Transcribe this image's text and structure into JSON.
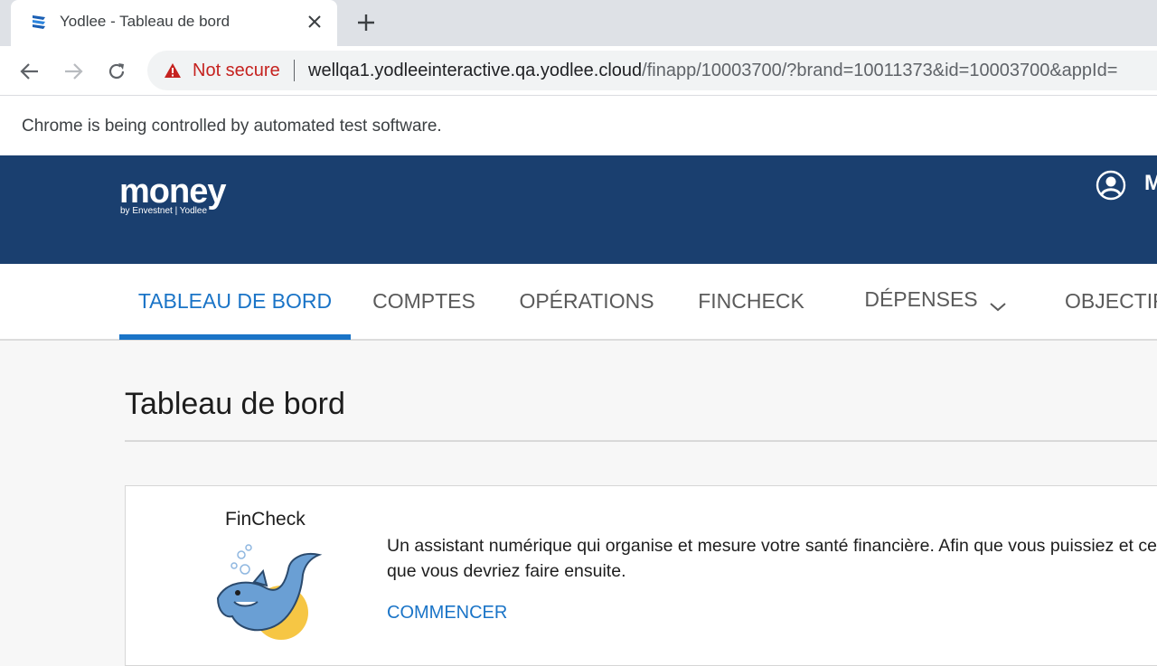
{
  "browser": {
    "tab_title": "Yodlee - Tableau de bord",
    "security_label": "Not secure",
    "url_host": "wellqa1.yodleeinteractive.qa.yodlee.cloud",
    "url_path": "/finapp/10003700/?brand=10011373&id=10003700&appId=",
    "automation_notice": "Chrome is being controlled by automated test software."
  },
  "header": {
    "logo_text": "money",
    "logo_subtext": "by Envestnet | Yodlee",
    "user_initial": "M"
  },
  "nav": {
    "items": [
      {
        "label": "TABLEAU DE BORD",
        "active": true
      },
      {
        "label": "COMPTES",
        "active": false
      },
      {
        "label": "OPÉRATIONS",
        "active": false
      },
      {
        "label": "FINCHECK",
        "active": false
      },
      {
        "label": "DÉPENSES",
        "active": false,
        "has_dropdown": true
      },
      {
        "label": "OBJECTIF",
        "active": false
      }
    ]
  },
  "main": {
    "page_title": "Tableau de bord",
    "fincheck_card": {
      "title": "FinCheck",
      "description": "Un assistant numérique qui organise et mesure votre santé financière. Afin que vous puissiez et ce que vous devriez faire ensuite.",
      "cta_label": "COMMENCER"
    }
  },
  "colors": {
    "brand_header": "#1a3f6f",
    "accent": "#1a74c7",
    "warning": "#c5221f"
  },
  "icons": {
    "favicon": "yodlee-favicon-icon",
    "close": "close-icon",
    "new_tab": "plus-icon",
    "back": "back-arrow-icon",
    "forward": "forward-arrow-icon",
    "reload": "reload-icon",
    "warning": "warning-triangle-icon",
    "user": "user-account-icon",
    "dropdown": "chevron-down-icon"
  }
}
